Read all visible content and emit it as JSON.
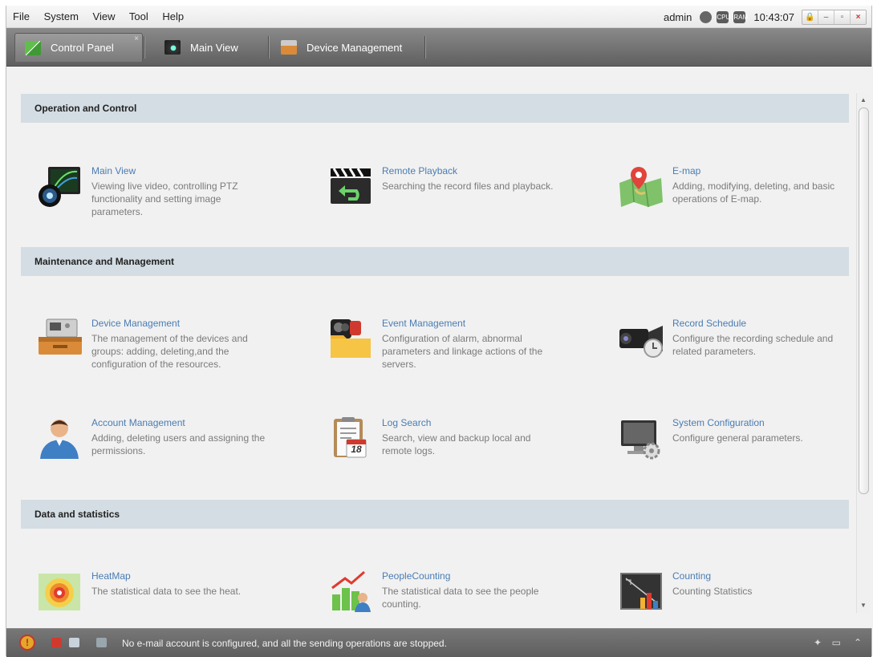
{
  "menubar": {
    "items": [
      "File",
      "System",
      "View",
      "Tool",
      "Help"
    ],
    "user": "admin",
    "cpu_label": "CPU",
    "ram_label": "RAM",
    "time": "10:43:07",
    "lock_label": "🔒",
    "minimize_label": "–",
    "maximize_label": "▫",
    "close_label": "×"
  },
  "tabs": [
    {
      "label": "Control Panel",
      "icon": "control-panel-icon",
      "active": true
    },
    {
      "label": "Main View",
      "icon": "main-view-icon"
    },
    {
      "label": "Device Management",
      "icon": "device-management-icon"
    }
  ],
  "tab_close_label": "×",
  "sections": [
    {
      "title": "Operation and Control"
    },
    {
      "title": "Maintenance and Management"
    },
    {
      "title": "Data and statistics"
    }
  ],
  "items": {
    "main_view": {
      "title": "Main View",
      "desc": "Viewing live video, controlling PTZ functionality and setting image parameters.",
      "icon": "camera-lens-icon"
    },
    "remote_playback": {
      "title": "Remote Playback",
      "desc": "Searching the record files and playback.",
      "icon": "clapperboard-icon"
    },
    "emap": {
      "title": "E-map",
      "desc": "Adding, modifying, deleting, and basic operations of E-map.",
      "icon": "map-pin-icon"
    },
    "device_management": {
      "title": "Device Management",
      "desc": "The management of the devices and groups: adding, deleting,and the configuration of the resources.",
      "icon": "device-tray-icon"
    },
    "event_management": {
      "title": "Event Management",
      "desc": "Configuration of alarm, abnormal parameters and linkage actions of the servers.",
      "icon": "event-folder-icon"
    },
    "record_schedule": {
      "title": "Record Schedule",
      "desc": "Configure the recording schedule and related parameters.",
      "icon": "video-camera-clock-icon"
    },
    "account_management": {
      "title": "Account Management",
      "desc": "Adding, deleting users and assigning the permissions.",
      "icon": "user-account-icon"
    },
    "log_search": {
      "title": "Log Search",
      "desc": "Search, view and backup local and remote logs.",
      "icon": "log-calendar-icon",
      "calendar_day": "18"
    },
    "system_configuration": {
      "title": "System Configuration",
      "desc": "Configure general parameters.",
      "icon": "monitor-gear-icon"
    },
    "heatmap": {
      "title": "HeatMap",
      "desc": "The statistical data to see the heat.",
      "icon": "heatmap-flame-icon"
    },
    "people_counting": {
      "title": "PeopleCounting",
      "desc": "The statistical data to see the people counting.",
      "icon": "people-chart-icon"
    },
    "counting": {
      "title": "Counting",
      "desc": "Counting Statistics",
      "icon": "counting-chart-icon"
    }
  },
  "scrollbar": {
    "up_label": "▲",
    "down_label": "▼"
  },
  "statusbar": {
    "alarm_label": "!",
    "message": "No e-mail account is configured, and all the sending operations are stopped.",
    "pin_label": "✦",
    "window_label": "▭",
    "expand_label": "⌃"
  },
  "colors": {
    "link_title": "#4a7cb3",
    "section_bg": "#d3dde3",
    "tabbar_bg": "#6e6e6e"
  }
}
